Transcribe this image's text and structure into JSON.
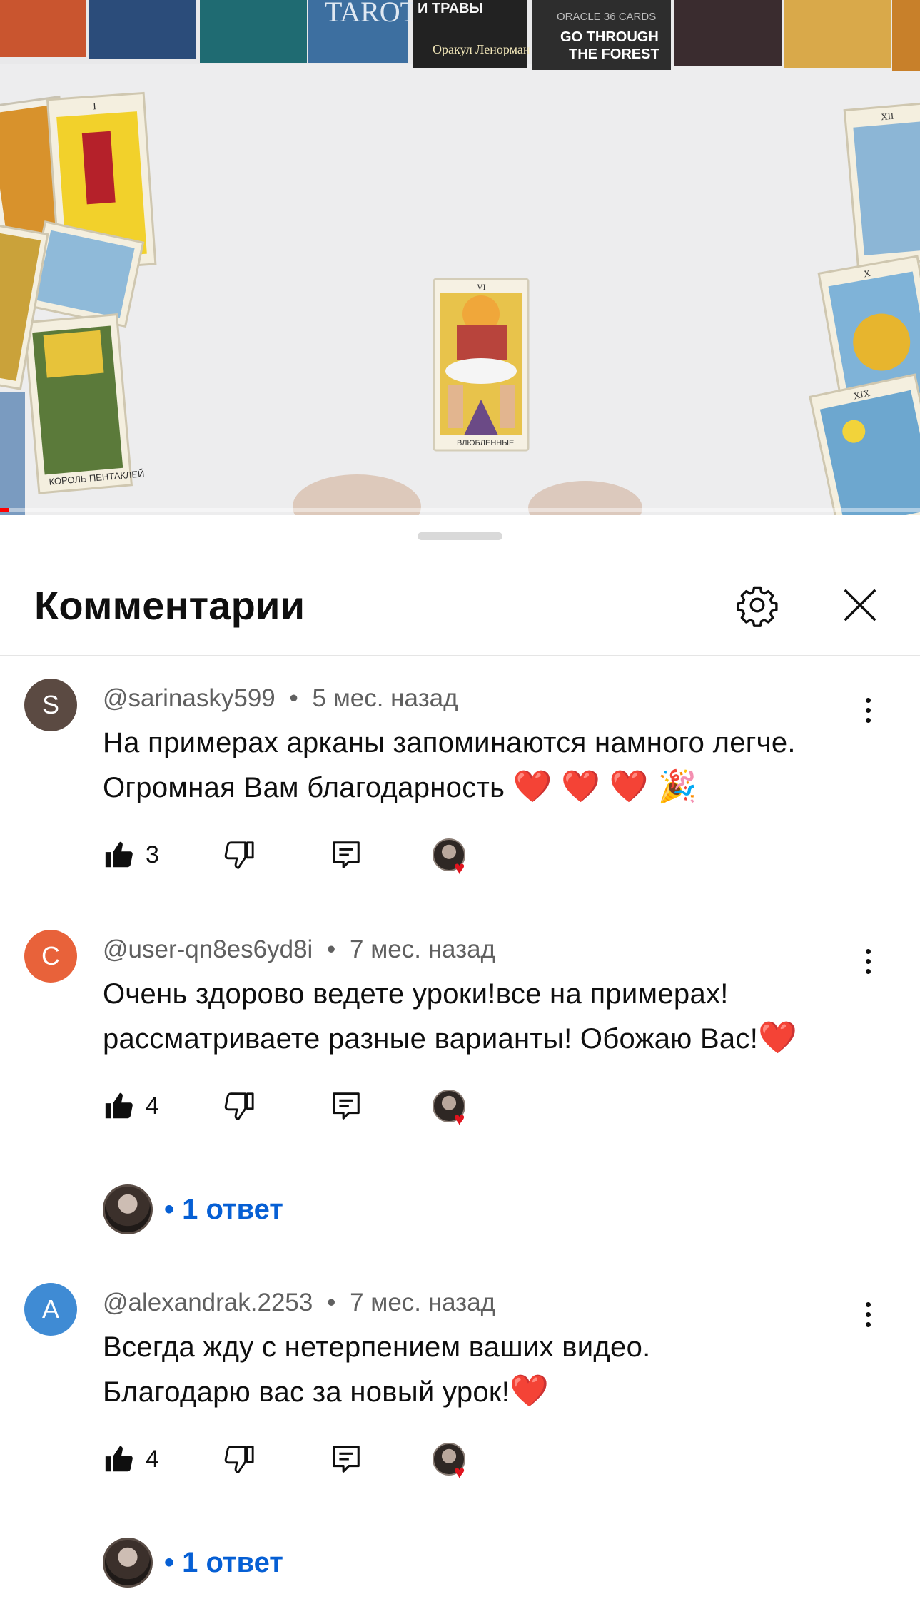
{
  "video": {
    "progress": 0.01,
    "visible_texts": {
      "oracle_brand": "ORACLE 36 CARDS",
      "oracle_title_line1": "GO THROUGH",
      "oracle_title_line2": "THE FOREST",
      "deck_title": "Оракул Ленорман",
      "deck_top": "И ТРАВЫ",
      "tarot_top": "TAROT",
      "card_center_caption": "ВЛЮБЛЕННЫЕ",
      "card_center_number": "VI",
      "card_king_caption": "КОРОЛЬ ПЕНТАКЛЕЙ",
      "card_magician_number": "I",
      "card_right_top_number": "XII",
      "card_right_mid_number": "X",
      "card_right_low_number": "XIX"
    }
  },
  "sheet": {
    "title": "Комментарии",
    "settings_icon": "gear-icon",
    "close_icon": "close-icon"
  },
  "colors": {
    "link_blue": "#065fd4",
    "heart_red": "#e0141e",
    "meta_gray": "#606060"
  },
  "comments": [
    {
      "avatar_letter": "S",
      "avatar_color": "#5b4a42",
      "author": "@sarinasky599",
      "separator": "•",
      "time": "5 мес. назад",
      "text_line1": "На примерах арканы запоминаются намного легче.",
      "text_line2": "Огромная Вам благодарность",
      "emoji": "❤️ ❤️ ❤️ 🎉",
      "likes": "3",
      "has_creator_heart": true
    },
    {
      "avatar_letter": "C",
      "avatar_color": "#e8623a",
      "author": "@user-qn8es6yd8i",
      "separator": "•",
      "time": "7 мес. назад",
      "text_line1": "Очень здорово ведете уроки!все на примерах!",
      "text_line2": "рассматриваете разные варианты! Обожаю Вас!",
      "emoji": "❤️",
      "likes": "4",
      "has_creator_heart": true,
      "replies_label": "• 1 ответ"
    },
    {
      "avatar_letter": "A",
      "avatar_color": "#3f8bd4",
      "author": "@alexandrak.2253",
      "separator": "•",
      "time": "7 мес. назад",
      "text_line1": "Всегда жду с нетерпением ваших видео.",
      "text_line2": "Благодарю вас за новый урок!",
      "emoji": "❤️",
      "likes": "4",
      "has_creator_heart": true,
      "replies_label": "• 1 ответ"
    }
  ]
}
